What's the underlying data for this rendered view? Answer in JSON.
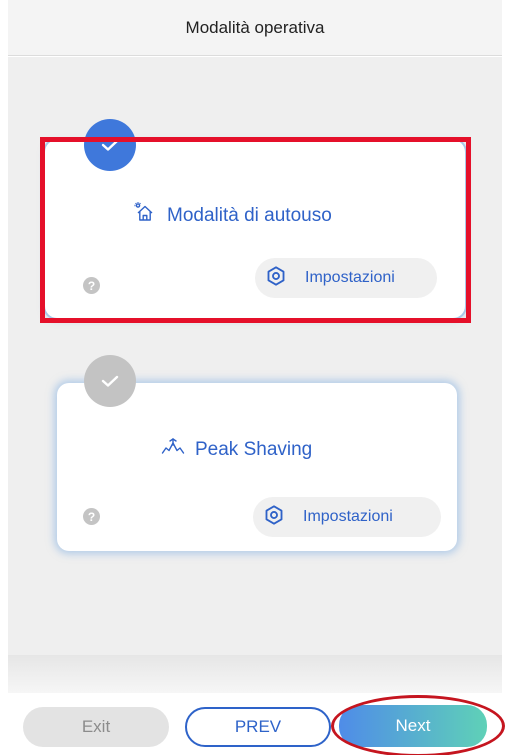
{
  "header": {
    "title": "Modalità operativa"
  },
  "modes": [
    {
      "title": "Modalità di autouso",
      "icon": "home-sun-icon",
      "selected": true,
      "settings_label": "Impostazioni",
      "help": "?"
    },
    {
      "title": "Peak Shaving",
      "icon": "peak-shaving-icon",
      "selected": false,
      "settings_label": "Impostazioni",
      "help": "?"
    }
  ],
  "footer": {
    "exit_label": "Exit",
    "prev_label": "PREV",
    "next_label": "Next"
  },
  "colors": {
    "accent": "#2f62c8",
    "selected_badge": "#3f78db",
    "unselected_badge": "#c3c3c3",
    "highlight": "#e5102a"
  }
}
